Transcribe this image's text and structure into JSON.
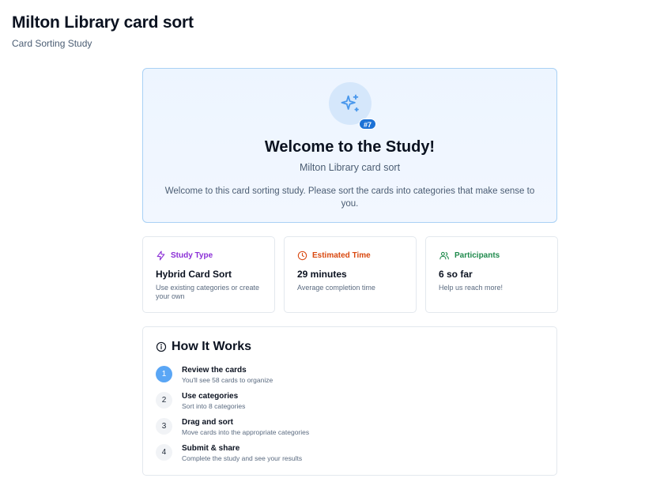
{
  "header": {
    "title": "Milton Library card sort",
    "subtitle": "Card Sorting Study"
  },
  "hero": {
    "icon": "sparkles-icon",
    "badge": "#7",
    "title": "Welcome to the Study!",
    "subtitle": "Milton Library card sort",
    "description": "Welcome to this card sorting study. Please sort the cards into categories that make sense to you."
  },
  "cards": [
    {
      "icon": "lightning-icon",
      "label": "Study Type",
      "value": "Hybrid Card Sort",
      "description": "Use existing categories or create your own",
      "color": "#8b2fd6"
    },
    {
      "icon": "clock-icon",
      "label": "Estimated Time",
      "value": "29 minutes",
      "description": "Average completion time",
      "color": "#d9480f"
    },
    {
      "icon": "users-icon",
      "label": "Participants",
      "value": "6 so far",
      "description": "Help us reach more!",
      "color": "#1f8a4c"
    }
  ],
  "how_it_works": {
    "title": "How It Works",
    "icon": "info-icon",
    "steps": [
      {
        "number": "1",
        "title": "Review the cards",
        "description": "You'll see 58 cards to organize"
      },
      {
        "number": "2",
        "title": "Use categories",
        "description": "Sort into 8 categories"
      },
      {
        "number": "3",
        "title": "Drag and sort",
        "description": "Move cards into the appropriate categories"
      },
      {
        "number": "4",
        "title": "Submit & share",
        "description": "Complete the study and see your results"
      }
    ]
  },
  "colors": {
    "accent": "#1d72d6",
    "hero_bg": "#edf5ff",
    "hero_border": "#a9d1f5",
    "active_step": "#5aa6f5"
  }
}
